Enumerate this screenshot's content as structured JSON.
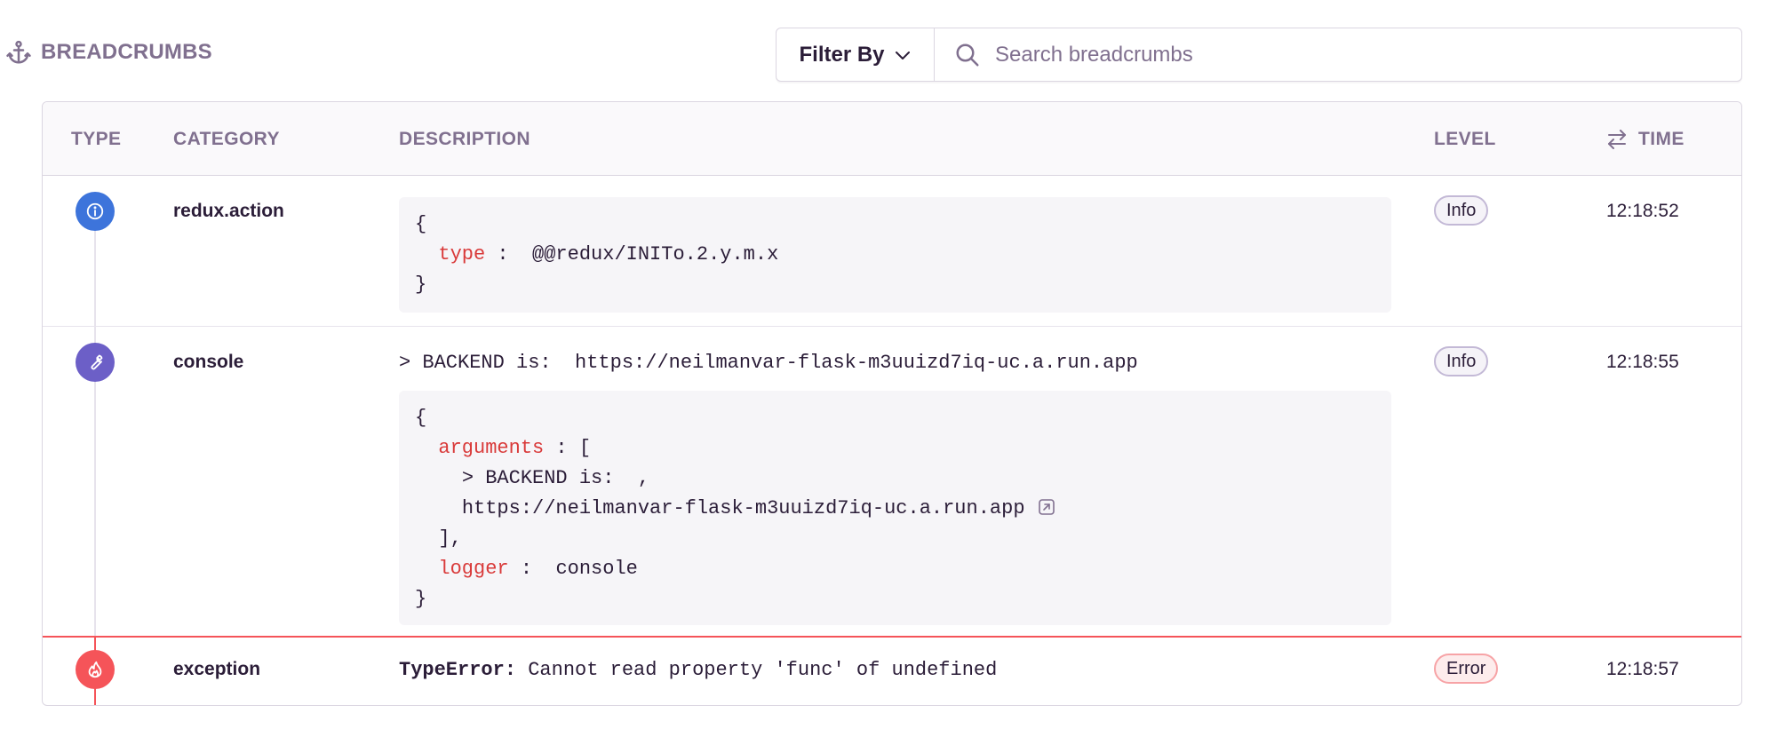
{
  "header": {
    "title": "BREADCRUMBS",
    "filter_label": "Filter By",
    "search_placeholder": "Search breadcrumbs"
  },
  "columns": {
    "type": "TYPE",
    "category": "CATEGORY",
    "description": "DESCRIPTION",
    "level": "LEVEL",
    "time": "TIME"
  },
  "rows": [
    {
      "type_icon": "info-icon",
      "category": "redux.action",
      "level": "Info",
      "time": "12:18:52",
      "code": {
        "open": "{",
        "key": "type",
        "sep": " :  ",
        "value": "@@redux/INITo.2.y.m.x",
        "close": "}"
      }
    },
    {
      "type_icon": "wrench-icon",
      "category": "console",
      "level": "Info",
      "time": "12:18:55",
      "message": "> BACKEND is:  https://neilmanvar-flask-m3uuizd7iq-uc.a.run.app",
      "code": {
        "open": "{",
        "args_key": "arguments",
        "args_sep": " : [",
        "arg1": "> BACKEND is:  ,",
        "arg2": "https://neilmanvar-flask-m3uuizd7iq-uc.a.run.app",
        "args_close": "],",
        "logger_key": "logger",
        "logger_sep": " :  ",
        "logger_value": "console",
        "close": "}"
      }
    },
    {
      "type_icon": "fire-icon",
      "category": "exception",
      "level": "Error",
      "time": "12:18:57",
      "error_type": "TypeError:",
      "error_message": " Cannot read property 'func' of undefined"
    }
  ],
  "colors": {
    "info": "#3d74db",
    "debug": "#6c5fc7",
    "error": "#f55459",
    "key": "#d93a3a",
    "muted": "#80708f"
  }
}
